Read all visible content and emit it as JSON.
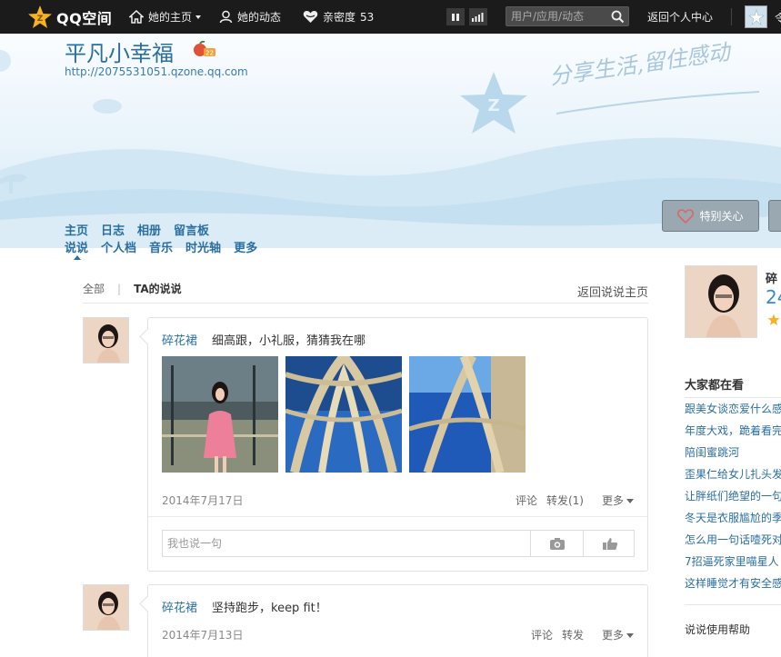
{
  "topbar": {
    "logo_text": "QQ空间",
    "home_label": "她的主页",
    "feeds_label": "她的动态",
    "intimacy_label": "亲密度",
    "intimacy_value": "53",
    "search_placeholder": "用户/应用/动态",
    "back_center_label": "返回个人中心"
  },
  "banner": {
    "space_title": "平凡小幸福",
    "space_url": "http://2075531051.qzone.qq.com",
    "slogan": "分享生活,留住感动",
    "care_button": "特别关心"
  },
  "nav": {
    "row1": [
      "主页",
      "日志",
      "相册",
      "留言板"
    ],
    "row2": [
      "说说",
      "个人档",
      "音乐",
      "时光轴",
      "更多"
    ]
  },
  "filter": {
    "all_label": "全部",
    "separator": "|",
    "ta_label": "TA的说说",
    "back_label": "返回说说主页"
  },
  "posts": [
    {
      "author": "碎花裙",
      "text": "细高跟，小礼服，猜猜我在哪",
      "date": "2014年7月17日",
      "comment_label": "评论",
      "forward_label": "转发(1)",
      "more_label": "更多",
      "reply_placeholder": "我也说一句"
    },
    {
      "author": "碎花裙",
      "text": "坚持跑步，keep fit！",
      "date": "2014年7月13日",
      "comment_label": "评论",
      "forward_label": "转发",
      "more_label": "更多"
    }
  ],
  "sidebar": {
    "name_partial": "碎",
    "number_partial": "24",
    "heading": "大家都在看",
    "items": [
      "跟美女谈恋爱什么感觉",
      "年度大戏，跪着看完",
      "陪闺蜜跳河",
      "歪果仁给女儿扎头发",
      "让胖纸们绝望的一句",
      "冬天是衣服尴尬的季",
      "怎么用一句话噎死对",
      "7招逼死家里喵星人",
      "这样睡觉才有安全感"
    ],
    "help_label": "说说使用帮助"
  },
  "colors": {
    "topbar_bg": "#1b1b1b",
    "link_blue": "#2a6fa0",
    "accent_gold": "#f5b324"
  }
}
